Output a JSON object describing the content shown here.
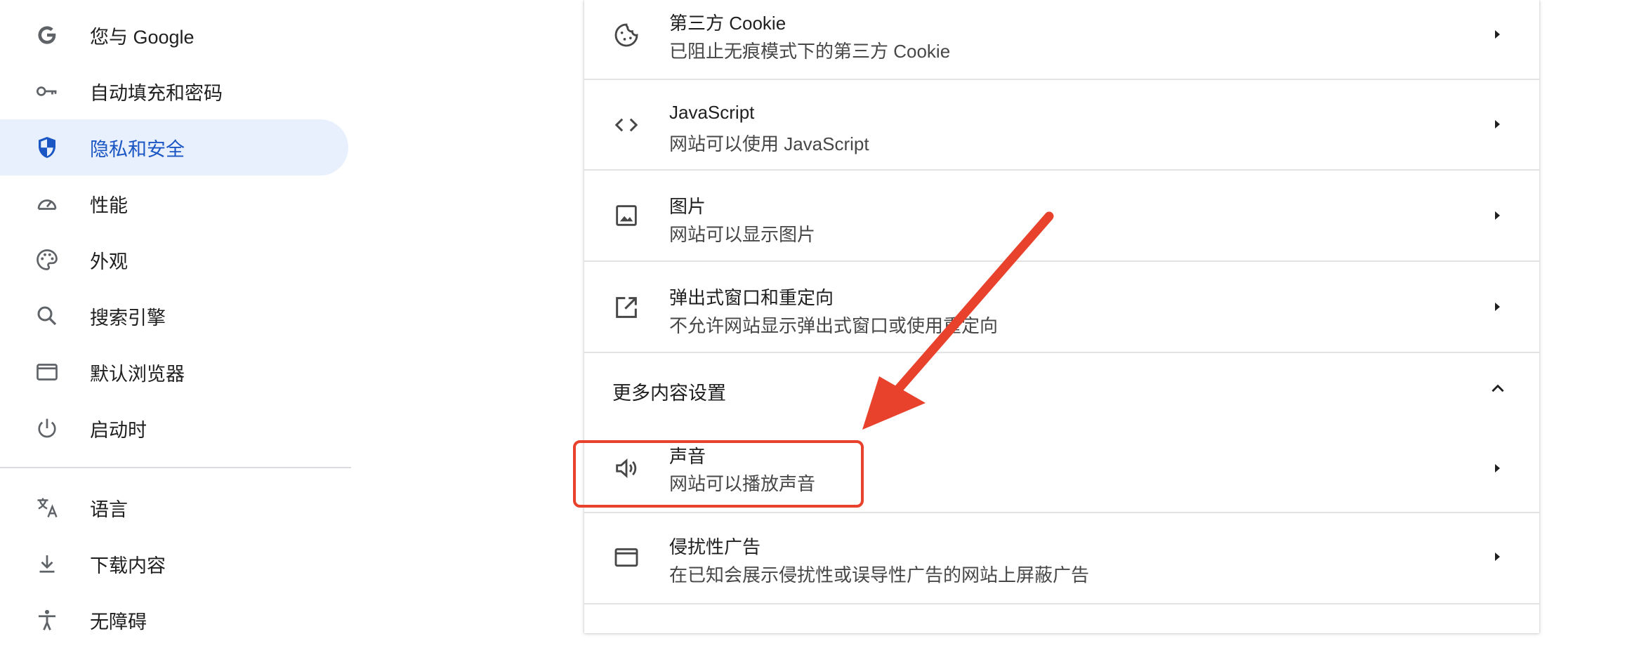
{
  "sidebar": {
    "items": [
      {
        "label": "您与 Google",
        "icon": "google-g-icon"
      },
      {
        "label": "自动填充和密码",
        "icon": "key-icon"
      },
      {
        "label": "隐私和安全",
        "icon": "shield-icon",
        "active": true
      },
      {
        "label": "性能",
        "icon": "speedometer-icon"
      },
      {
        "label": "外观",
        "icon": "palette-icon"
      },
      {
        "label": "搜索引擎",
        "icon": "search-icon"
      },
      {
        "label": "默认浏览器",
        "icon": "browser-window-icon"
      },
      {
        "label": "启动时",
        "icon": "power-icon"
      },
      {
        "label": "语言",
        "icon": "translate-icon"
      },
      {
        "label": "下载内容",
        "icon": "download-icon"
      },
      {
        "label": "无障碍",
        "icon": "accessibility-icon"
      }
    ]
  },
  "content": {
    "cookies": {
      "title": "第三方 Cookie",
      "subtitle": "已阻止无痕模式下的第三方 Cookie"
    },
    "javascript": {
      "title": "JavaScript",
      "subtitle": "网站可以使用 JavaScript"
    },
    "images": {
      "title": "图片",
      "subtitle": "网站可以显示图片"
    },
    "popups": {
      "title": "弹出式窗口和重定向",
      "subtitle": "不允许网站显示弹出式窗口或使用重定向"
    },
    "more_settings": {
      "label": "更多内容设置"
    },
    "sound": {
      "title": "声音",
      "subtitle": "网站可以播放声音"
    },
    "intrusive_ads": {
      "title": "侵扰性广告",
      "subtitle": "在已知会展示侵扰性或误导性广告的网站上屏蔽广告"
    }
  },
  "colors": {
    "accent": "#1a56c4",
    "active_bg": "#e8effd",
    "annotation": "#e8412c"
  }
}
